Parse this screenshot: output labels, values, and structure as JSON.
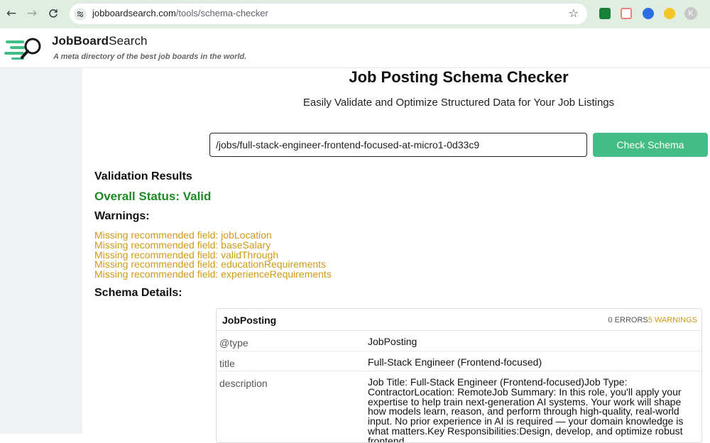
{
  "browser": {
    "url_host": "jobboardsearch.com",
    "url_path": "/tools/schema-checker",
    "profile_initial": "K"
  },
  "site": {
    "brand_bold": "JobBoard",
    "brand_rest": "Search",
    "tagline": "A meta directory of the best job boards in the world."
  },
  "page": {
    "title": "Job Posting Schema Checker",
    "subtitle": "Easily Validate and Optimize Structured Data for Your Job Listings"
  },
  "checker": {
    "input_value": "/jobs/full-stack-engineer-frontend-focused-at-micro1-0d33c9",
    "button_label": "Check Schema"
  },
  "results": {
    "heading": "Validation Results",
    "status": "Overall Status: Valid",
    "warnings_heading": "Warnings:",
    "warnings": [
      "Missing recommended field: jobLocation",
      "Missing recommended field: baseSalary",
      "Missing recommended field: validThrough",
      "Missing recommended field: educationRequirements",
      "Missing recommended field: experienceRequirements"
    ],
    "details_heading": "Schema Details:"
  },
  "schema_card": {
    "title": "JobPosting",
    "errors": "0 ERRORS",
    "warnings": "5 WARNINGS",
    "rows": [
      {
        "key": "@type",
        "value": "JobPosting"
      },
      {
        "key": "title",
        "value": "Full-Stack Engineer (Frontend-focused)"
      },
      {
        "key": "description",
        "value": "Job Title:  Full-Stack Engineer (Frontend-focused)Job Type:  ContractorLocation:  RemoteJob Summary:  In this role, you'll apply your expertise to help train next-generation AI systems. Your work will shape how models learn, reason, and perform through high-quality, real-world input. No prior experience in AI is required — your domain knowledge is what matters.Key Responsibilities:Design, develop, and optimize robust frontend"
      }
    ]
  },
  "colors": {
    "chrome_bg": "#dfeee1",
    "accent_green": "#43bd85",
    "status_green": "#1d8a26",
    "warning_gold": "#cf9a16"
  },
  "icons": [
    "back-arrow-icon",
    "forward-arrow-icon",
    "reload-icon",
    "site-settings-icon",
    "bookmark-star-icon",
    "magnifier-logo-icon"
  ]
}
